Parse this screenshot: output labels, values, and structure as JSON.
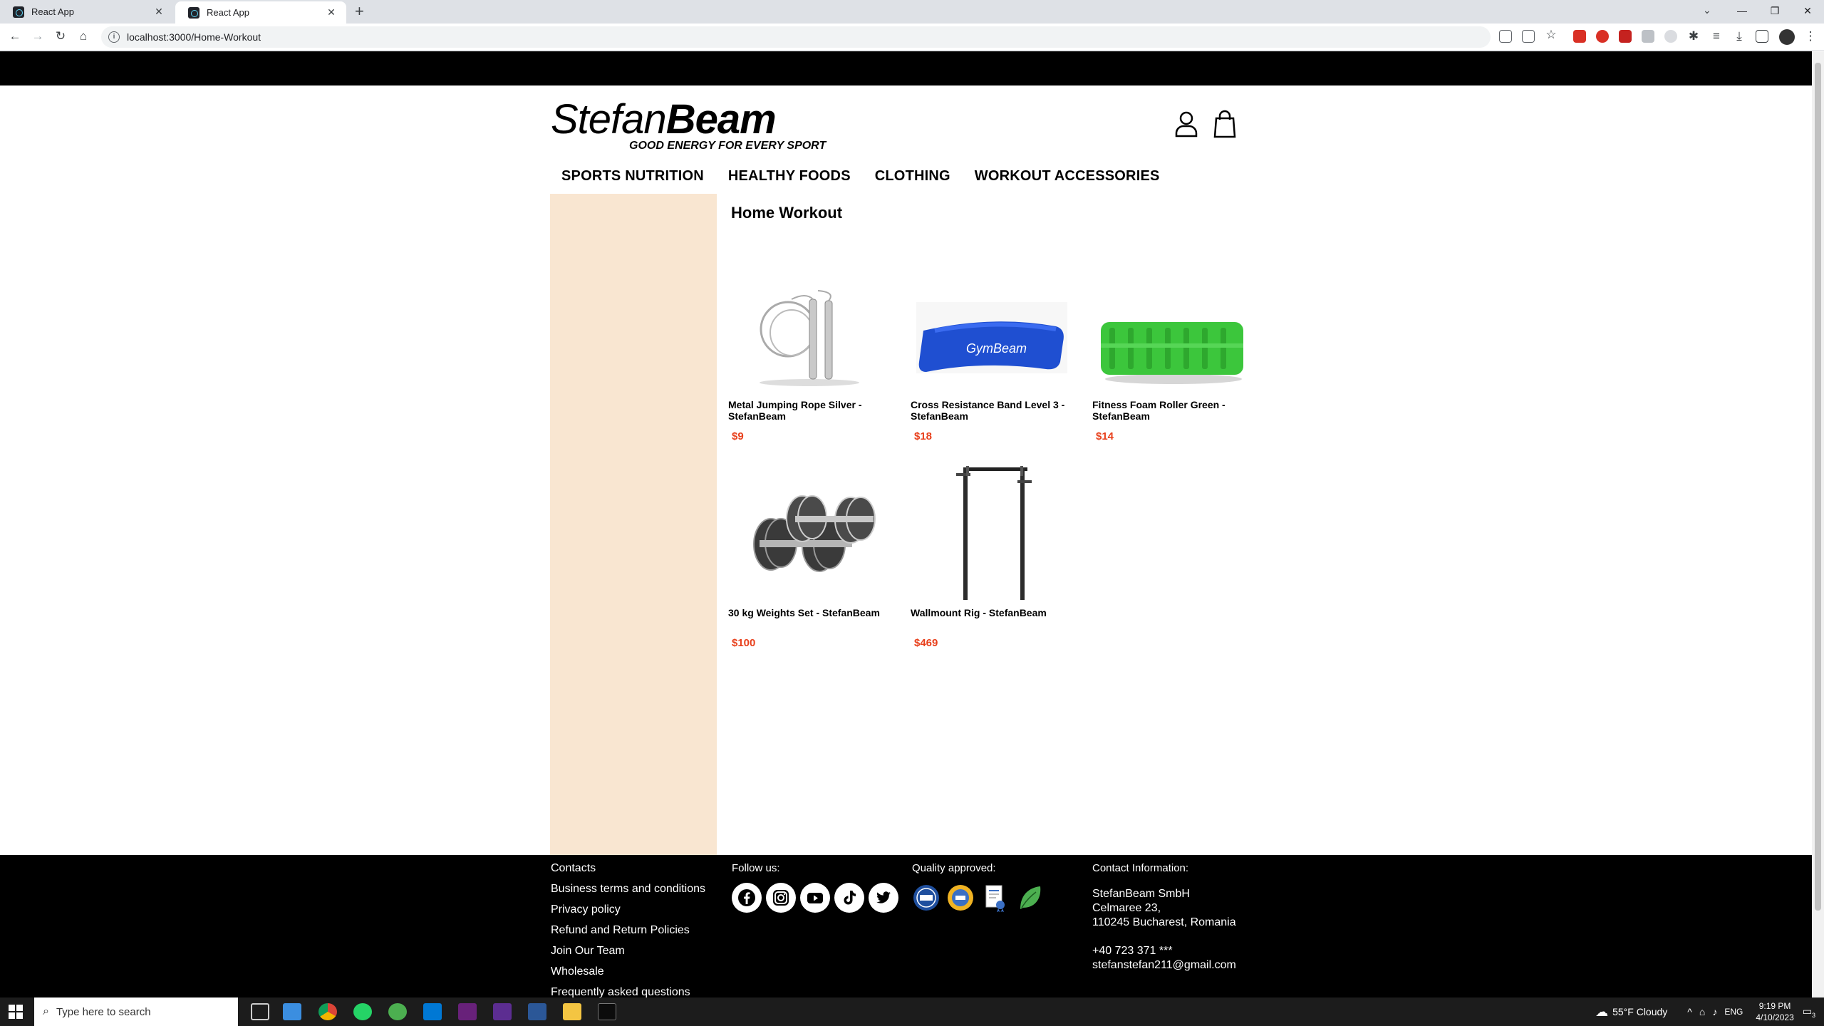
{
  "browser": {
    "tabs": [
      {
        "label": "React App",
        "active": false
      },
      {
        "label": "React App",
        "active": true
      }
    ],
    "new_tab_symbol": "+",
    "url": "localhost:3000/Home-Workout"
  },
  "site": {
    "brand_light": "Stefan",
    "brand_bold": "Beam",
    "tagline": "GOOD ENERGY FOR EVERY SPORT",
    "nav": [
      "SPORTS NUTRITION",
      "HEALTHY FOODS",
      "CLOTHING",
      "WORKOUT ACCESSORIES"
    ],
    "page_title": "Home Workout",
    "colors": {
      "sidebar": "#f9e6d1",
      "price": "#e8401c",
      "footer": "#000000"
    }
  },
  "products": [
    {
      "name": "Metal Jumping Rope Silver - StefanBeam",
      "price": "$9",
      "icon": "jump-rope"
    },
    {
      "name": "Cross Resistance Band Level 3 - StefanBeam",
      "price": "$18",
      "icon": "resistance-band",
      "band_text": "GymBeam"
    },
    {
      "name": "Fitness Foam Roller Green - StefanBeam",
      "price": "$14",
      "icon": "foam-roller"
    },
    {
      "name": "30 kg Weights Set - StefanBeam",
      "price": "$100",
      "icon": "dumbbells"
    },
    {
      "name": "Wallmount Rig - StefanBeam",
      "price": "$469",
      "icon": "wall-rig"
    }
  ],
  "footer": {
    "links": [
      "Contacts",
      "Business terms and conditions",
      "Privacy policy",
      "Refund and Return Policies",
      "Join Our Team",
      "Wholesale",
      "Frequently asked questions"
    ],
    "follow_label": "Follow us:",
    "social": [
      "facebook-icon",
      "instagram-icon",
      "youtube-icon",
      "tiktok-icon",
      "twitter-icon"
    ],
    "quality_label": "Quality approved:",
    "quality_badges": [
      "iso-badge",
      "ifs-badge",
      "certificate-badge",
      "eco-leaf-badge"
    ],
    "contact_label": "Contact Information:",
    "company": "StefanBeam SmbH",
    "street": "Celmaree 23,",
    "city": "110245 Bucharest, Romania",
    "phone": "+40 723 371 ***",
    "email": "stefanstefan211@gmail.com"
  },
  "taskbar": {
    "search_placeholder": "Type here to search",
    "weather": "55°F  Cloudy",
    "lang": "ENG",
    "time": "9:19 PM",
    "date": "4/10/2023",
    "notifications": "3"
  }
}
